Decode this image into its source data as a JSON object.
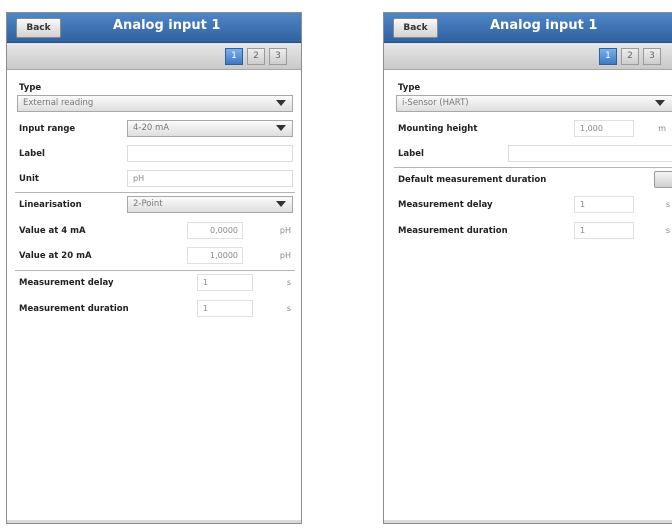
{
  "left_screen": {
    "back_label": "Back",
    "title": "Analog input 1",
    "tabs": [
      "1",
      "2",
      "3"
    ],
    "type_label": "Type",
    "type_value": "External reading",
    "input_range_label": "Input range",
    "input_range_value": "4-20 mA",
    "label_label": "Label",
    "label_value": "",
    "unit_label": "Unit",
    "unit_value": "pH",
    "linearisation_label": "Linearisation",
    "linearisation_value": "2-Point",
    "value_4ma_label": "Value at 4 mA",
    "value_4ma": "0,0000",
    "value_4ma_unit": "pH",
    "value_20ma_label": "Value at 20 mA",
    "value_20ma": "1,0000",
    "value_20ma_unit": "pH",
    "measurement_delay_label": "Measurement delay",
    "measurement_delay_value": "1",
    "measurement_delay_unit": "s",
    "measurement_duration_label": "Measurement duration",
    "measurement_duration_value": "1",
    "measurement_duration_unit": "s"
  },
  "right_screen": {
    "back_label": "Back",
    "title": "Analog input 1",
    "tabs": [
      "1",
      "2",
      "3"
    ],
    "type_label": "Type",
    "type_value": "i-Sensor (HART)",
    "mounting_height_label": "Mounting height",
    "mounting_height_value": "1,000",
    "mounting_height_unit": "m",
    "label_label": "Label",
    "label_value": "",
    "default_duration_label": "Default measurement duration",
    "measurement_delay_label": "Measurement delay",
    "measurement_delay_value": "1",
    "measurement_delay_unit": "s",
    "measurement_duration_label": "Measurement duration",
    "measurement_duration_value": "1",
    "measurement_duration_unit": "s"
  },
  "colors": {
    "titlebar_top": "#4f86c7",
    "titlebar_bottom": "#2f61a0",
    "active_tab": "#3d78c3",
    "divider": "#b5b5b5"
  },
  "icons": {
    "dropdown_arrow": "chevron-down-icon"
  }
}
